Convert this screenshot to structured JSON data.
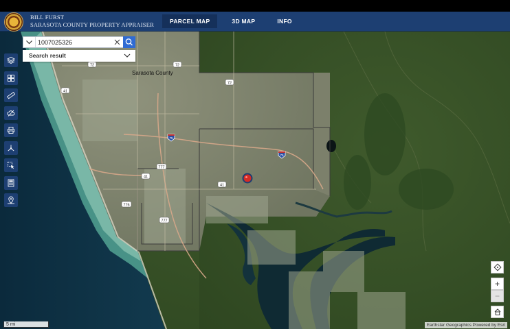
{
  "header": {
    "office_line1": "BILL FURST",
    "office_line2": "SARASOTA COUNTY PROPERTY APPRAISER",
    "nav": [
      {
        "label": "PARCEL MAP",
        "active": true
      },
      {
        "label": "3D MAP",
        "active": false
      },
      {
        "label": "INFO",
        "active": false
      }
    ]
  },
  "search": {
    "value": "1007025326",
    "result_label": "Search result"
  },
  "map": {
    "county_label": "Sarasota County",
    "road_shields": [
      "72",
      "72",
      "72",
      "41",
      "75",
      "75",
      "777",
      "41",
      "41",
      "776",
      "777"
    ]
  },
  "toolbar": {
    "icons": [
      "layers-icon",
      "grid-icon",
      "measure-icon",
      "cloud-icon",
      "print-icon",
      "share-icon",
      "select-icon",
      "calculator-icon",
      "person-pin-icon"
    ]
  },
  "controls": {
    "zoom_in": "+",
    "zoom_out": "−",
    "zoom_out_disabled": true
  },
  "scale": {
    "label": "5 mi"
  },
  "attribution": "Earthstar Geographics  Powered by Esri",
  "colors": {
    "header_bg": "#1d3f72",
    "search_button": "#2f6bd3",
    "marker": "#d52b25"
  }
}
